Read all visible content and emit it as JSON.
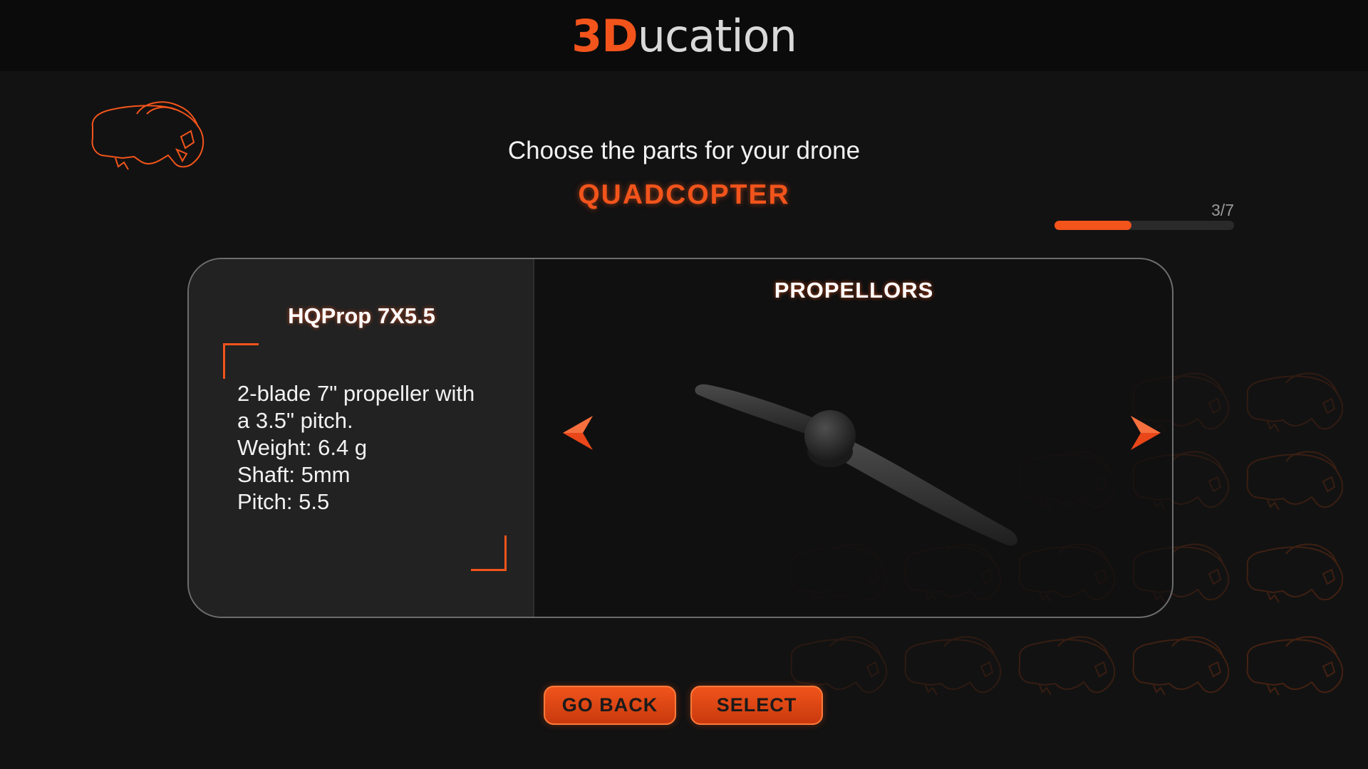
{
  "header": {
    "logo_part1": "3D",
    "logo_part2": "ucation"
  },
  "page": {
    "subtitle": "Choose the parts for your drone",
    "drone_type": "QUADCOPTER"
  },
  "progress": {
    "label": "3/7",
    "current": 3,
    "total": 7
  },
  "part": {
    "name": "HQProp 7X5.5",
    "description_lines": [
      "2-blade 7\" propeller with",
      "a 3.5\" pitch.",
      "Weight: 6.4 g",
      "Shaft: 5mm",
      "Pitch: 5.5"
    ]
  },
  "category": {
    "title": "PROPELLORS"
  },
  "buttons": {
    "back": "GO BACK",
    "select": "SELECT"
  },
  "icons": {
    "corner": "vr-headset-icon",
    "prev": "arrow-left-icon",
    "next": "arrow-right-icon",
    "watermark": "vr-headset-pattern"
  },
  "colors": {
    "accent": "#f2541b",
    "background": "#121212",
    "panel": "#222222"
  }
}
